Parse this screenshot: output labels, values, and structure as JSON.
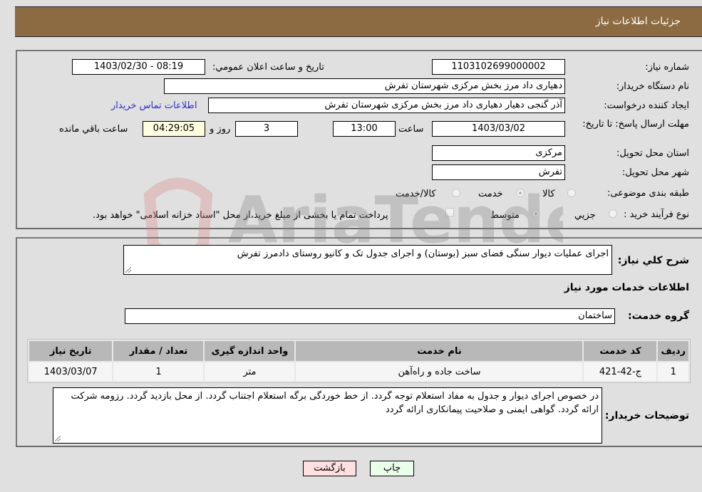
{
  "header": {
    "title": "جزئیات اطلاعات نیاز"
  },
  "details": {
    "need_number_label": "شماره نیاز:",
    "need_number": "1103102699000002",
    "announce_label": "تاریخ و ساعت اعلان عمومي:",
    "announce_value": "1403/02/30 - 08:19",
    "buyer_org_label": "نام دستگاه خریدار:",
    "buyer_org": "دهیاری داد مرز  بخش مرکزی شهرستان تفرش",
    "creator_label": "ایجاد کننده درخواست:",
    "creator": "آذر گنجی دهیار دهیاری داد مرز  بخش مرکزی شهرستان تفرش",
    "contact_link": "اطلاعات تماس خریدار",
    "deadline_label": "مهلت ارسال پاسخ: تا تاریخ:",
    "deadline_date": "1403/03/02",
    "time_label": "ساعت",
    "deadline_time": "13:00",
    "days_value": "3",
    "days_label": "روز و",
    "remaining_time": "04:29:05",
    "remaining_label": "ساعت باقي مانده",
    "province_label": "استان محل تحویل:",
    "province": "مرکزی",
    "city_label": "شهر محل تحویل:",
    "city": "تفرش",
    "category_label": "طبقه بندی موضوعی:",
    "category_options": [
      {
        "label": "کالا",
        "selected": false
      },
      {
        "label": "خدمت",
        "selected": true
      },
      {
        "label": "کالا/خدمت",
        "selected": false
      }
    ],
    "process_label": "نوع فرآیند خرید :",
    "process_options": [
      {
        "label": "جزيي",
        "selected": false
      },
      {
        "label": "متوسط",
        "selected": true
      }
    ],
    "treasury_note": "پرداخت تمام یا بخشی از مبلغ خرید،از محل \"اسناد خزانه اسلامی\" خواهد بود.",
    "treasury_checked": false
  },
  "services": {
    "summary_label": "شرح کلي نیاز:",
    "summary": "اجرای عملیات دیوار سنگی فضای سبز (بوستان) و اجرای جدول تک و کانیو روستای دادمرز تفرش",
    "section_title": "اطلاعات خدمات مورد نیاز",
    "group_label": "گروه خدمت:",
    "group_value": "ساختمان",
    "table": {
      "headers": [
        "ردیف",
        "کد خدمت",
        "نام خدمت",
        "واحد اندازه گیری",
        "تعداد / مقدار",
        "تاریخ نیاز"
      ],
      "rows": [
        [
          "1",
          "ج-42-421",
          "ساخت جاده و راه‌آهن",
          "متر",
          "1",
          "1403/03/07"
        ]
      ]
    },
    "buyer_notes_label": "توضیحات خریدار:",
    "buyer_notes": "در خصوص اجرای دیوار و جدول به مفاد استعلام توجه گردد. از خط خوردگی برگه استعلام اجتناب گردد. از محل بازدید گردد. رزومه شرکت ارائه گردد. گواهی ایمنی و صلاحیت پیمانکاری ارائه گردد"
  },
  "buttons": {
    "print": "چاپ",
    "back": "بازگشت"
  },
  "watermark": {
    "text": "AriaTender.neT"
  },
  "colors": {
    "header_bg": "#8c6b42",
    "print_bg": "#eaffea",
    "back_bg": "#ffe0e0",
    "link": "#2d2dd2"
  }
}
